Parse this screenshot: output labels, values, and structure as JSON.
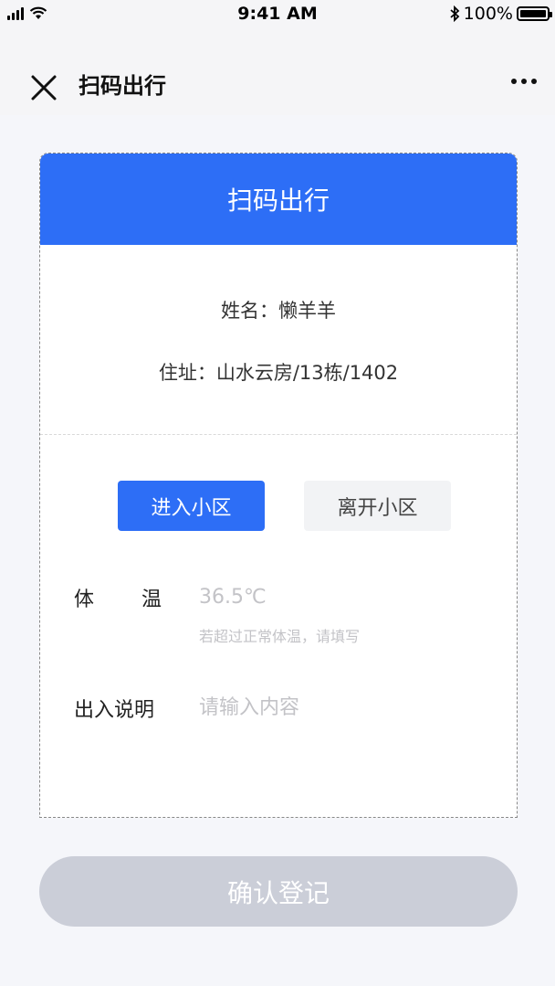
{
  "status_bar": {
    "time": "9:41 AM",
    "battery": "100%"
  },
  "nav": {
    "title": "扫码出行"
  },
  "card": {
    "header_title": "扫码出行",
    "name_line": "姓名：懒羊羊",
    "address_line": "住址：山水云房/13栋/1402"
  },
  "direction": {
    "enter_label": "进入小区",
    "leave_label": "离开小区",
    "selected": "进入小区"
  },
  "temperature": {
    "label_part1": "体",
    "label_part2": "温",
    "placeholder": "36.5℃",
    "hint": "若超过正常体温，请填写"
  },
  "remark": {
    "label": "出入说明",
    "placeholder": "请输入内容"
  },
  "confirm": {
    "label": "确认登记"
  },
  "colors": {
    "accent": "#2d6ef6",
    "disabled_button": "#cbced8"
  }
}
